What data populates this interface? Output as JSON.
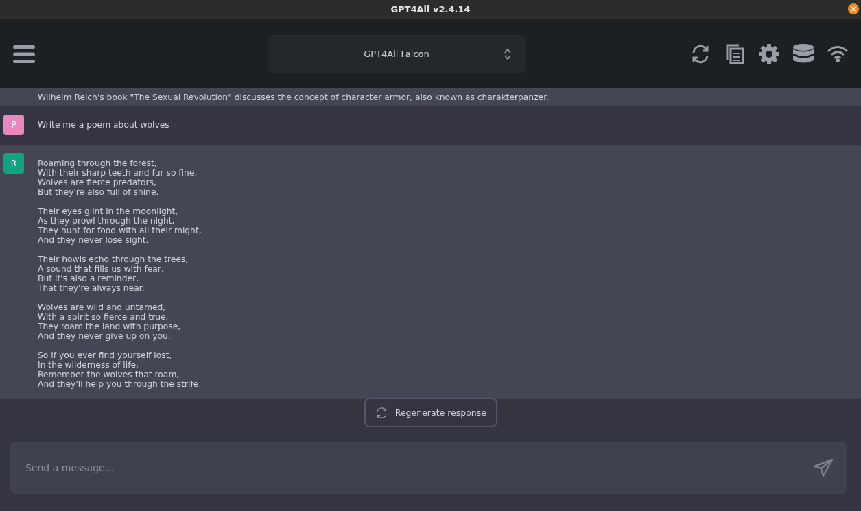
{
  "window": {
    "title": "GPT4All v2.4.14"
  },
  "header": {
    "model": "GPT4All Falcon"
  },
  "messages": [
    {
      "kind": "response",
      "text": "Wilhelm Reich's book \"The Sexual Revolution\" discusses the concept of character armor, also known as charakterpanzer."
    },
    {
      "kind": "prompt",
      "avatar": "P",
      "color": "#ec86bf",
      "text": "Write me a poem about wolves"
    },
    {
      "kind": "response",
      "avatar": "R",
      "color": "#10a37f",
      "text": "Roaming through the forest,\nWith their sharp teeth and fur so fine,\nWolves are fierce predators,\nBut they're also full of shine.\n\nTheir eyes glint in the moonlight,\nAs they prowl through the night,\nThey hunt for food with all their might,\nAnd they never lose sight.\n\nTheir howls echo through the trees,\nA sound that fills us with fear,\nBut it's also a reminder,\nThat they're always near.\n\nWolves are wild and untamed,\nWith a spirit so fierce and true,\nThey roam the land with purpose,\nAnd they never give up on you.\n\nSo if you ever find yourself lost,\nIn the wilderness of life,\nRemember the wolves that roam,\nAnd they'll help you through the strife."
    }
  ],
  "regenerate": {
    "label": "Regenerate response"
  },
  "input": {
    "placeholder": "Send a message..."
  }
}
